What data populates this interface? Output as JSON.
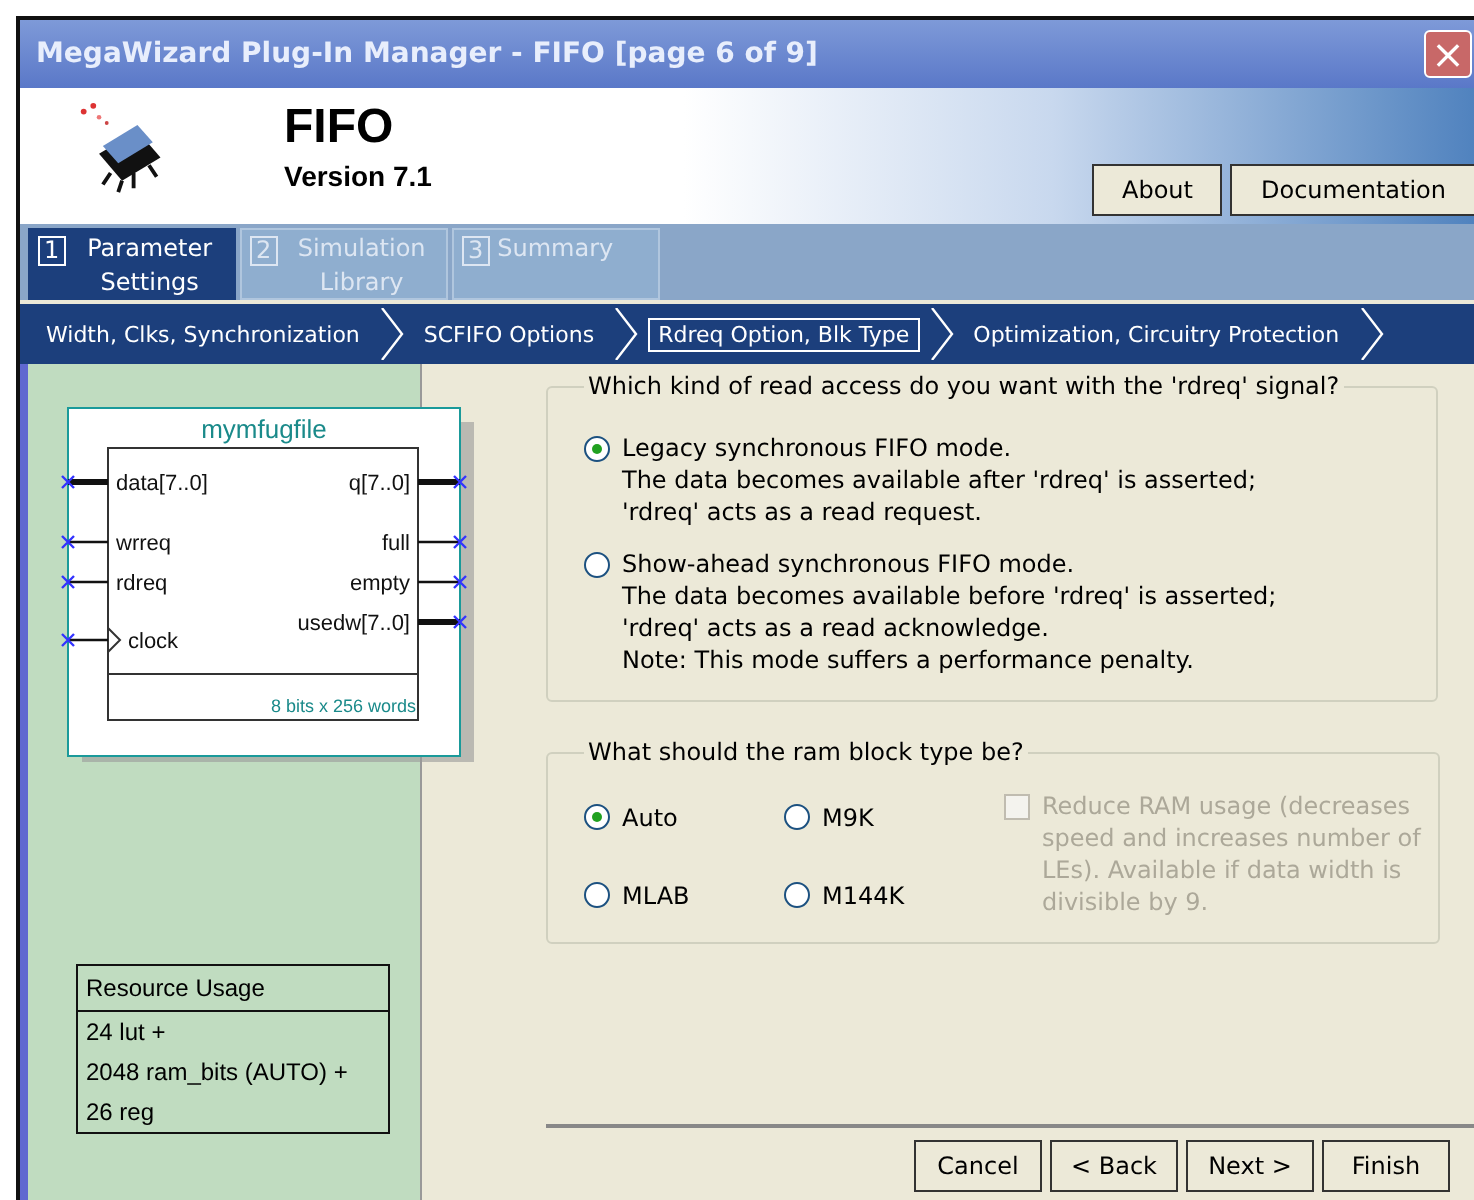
{
  "window": {
    "title": "MegaWizard Plug-In Manager - FIFO [page 6 of 9]",
    "close": "×"
  },
  "header": {
    "title": "FIFO",
    "version": "Version 7.1",
    "buttons": [
      "About",
      "Documentation"
    ]
  },
  "tabs": [
    {
      "number": "1",
      "label": "Parameter Settings",
      "selected": true
    },
    {
      "number": "2",
      "label": "Simulation Library",
      "selected": false
    },
    {
      "number": "3",
      "label": "Summary",
      "selected": false
    }
  ],
  "steps": [
    {
      "label": "Width, Clks, Synchronization",
      "selected": false
    },
    {
      "label": "SCFIFO Options",
      "selected": false
    },
    {
      "label": "Rdreq Option, Blk Type",
      "selected": true
    },
    {
      "label": "Optimization, Circuitry Protection",
      "selected": false
    }
  ],
  "symbol": {
    "name": "mymfugfile",
    "inputs": [
      {
        "label": "data[7..0]",
        "kind": "bus"
      },
      {
        "label": "wrreq",
        "kind": "wire"
      },
      {
        "label": "rdreq",
        "kind": "wire"
      },
      {
        "label": "clock",
        "kind": "clock"
      }
    ],
    "outputs": [
      {
        "label": "q[7..0]",
        "kind": "bus"
      },
      {
        "label": "full",
        "kind": "wire"
      },
      {
        "label": "empty",
        "kind": "wire"
      },
      {
        "label": "usedw[7..0]",
        "kind": "bus"
      }
    ],
    "footer": "8 bits x 256 words"
  },
  "resource_usage": {
    "title": "Resource Usage",
    "lines": [
      "24 lut +",
      "2048 ram_bits (AUTO) +",
      "26 reg"
    ]
  },
  "read_access": {
    "legend": "Which kind of read access do you want with the 'rdreq' signal?",
    "options": [
      {
        "label": "Legacy synchronous FIFO mode.",
        "lines": [
          "The data becomes available after 'rdreq' is asserted;",
          "'rdreq' acts as a read request."
        ],
        "selected": true
      },
      {
        "label": "Show-ahead synchronous FIFO mode.",
        "lines": [
          "The data becomes available before 'rdreq' is asserted;",
          "'rdreq' acts as a read acknowledge.",
          "Note: This mode suffers a performance penalty."
        ],
        "selected": false
      }
    ]
  },
  "ram_block": {
    "legend": "What should the ram block type be?",
    "options": [
      {
        "label": "Auto",
        "selected": true
      },
      {
        "label": "M9K",
        "selected": false
      },
      {
        "label": "MLAB",
        "selected": false
      },
      {
        "label": "M144K",
        "selected": false
      }
    ],
    "reduce_ram": {
      "label": "Reduce RAM usage (decreases speed and increases number of LEs).  Available if data width is divisible by 9.",
      "checked": false,
      "disabled": true
    }
  },
  "buttons": [
    "Cancel",
    "< Back",
    "Next >",
    "Finish"
  ]
}
